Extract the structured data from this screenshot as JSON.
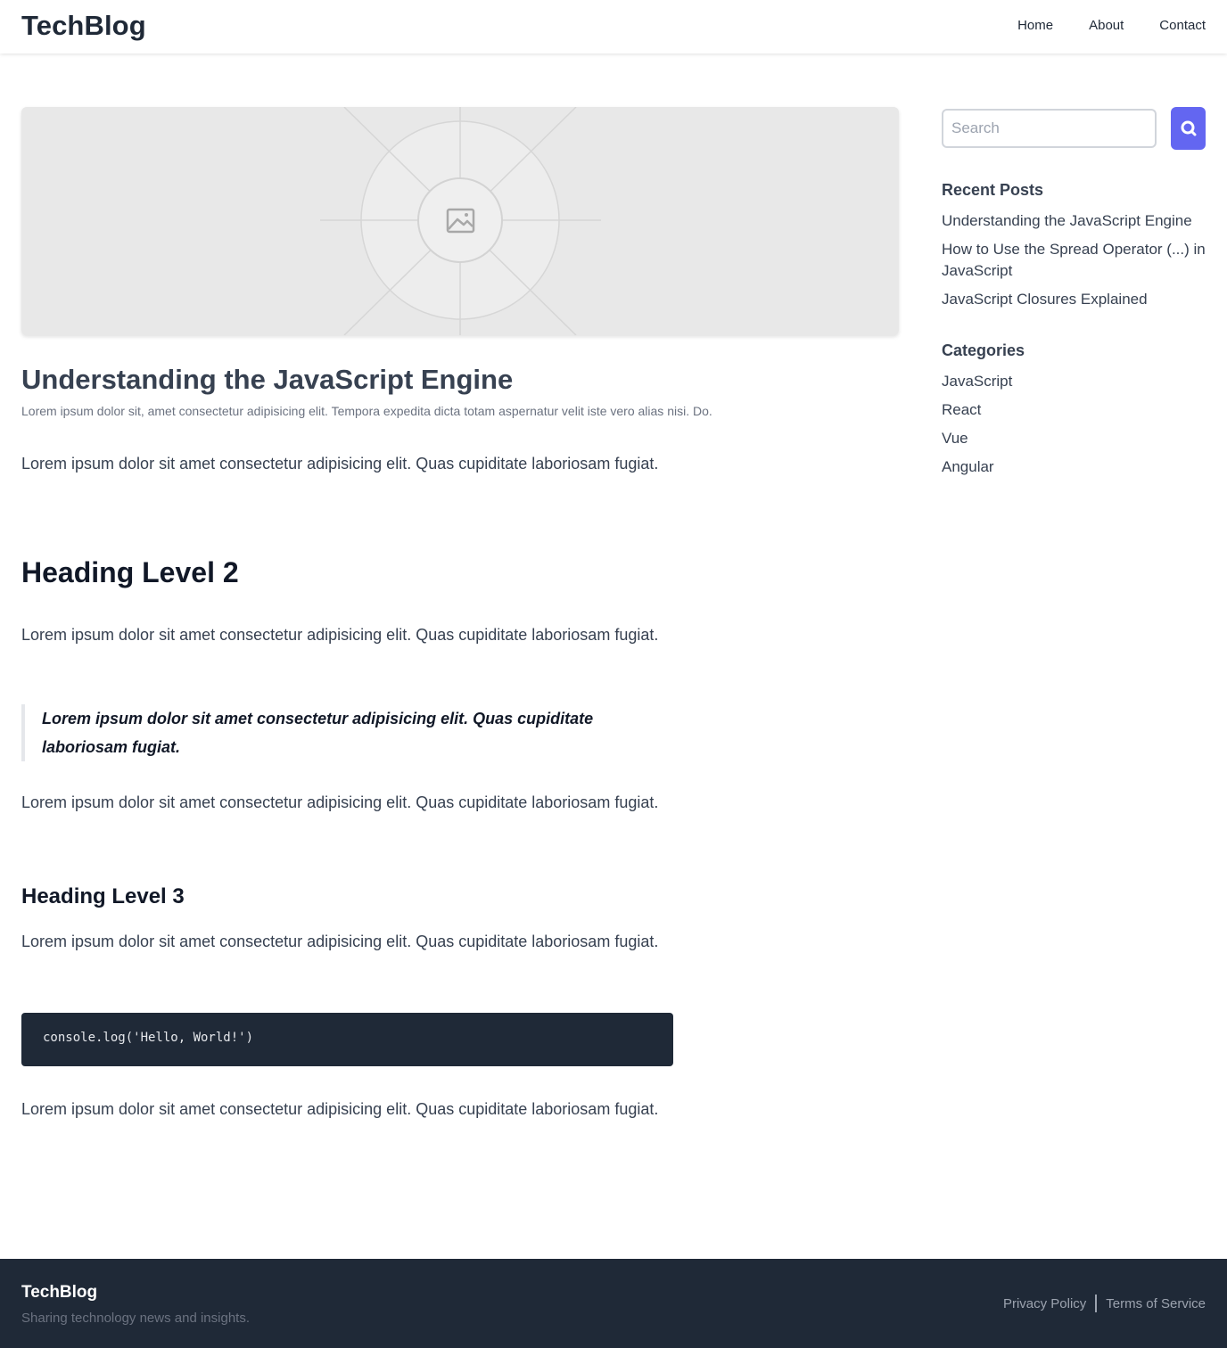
{
  "header": {
    "brand": "TechBlog",
    "nav": [
      "Home",
      "About",
      "Contact"
    ]
  },
  "post": {
    "image": "image-placeholder",
    "title": "Understanding the JavaScript Engine",
    "excerpt": "Lorem ipsum dolor sit, amet consectetur adipisicing elit. Tempora expedita dicta totam aspernatur velit iste vero alias nisi. Do.",
    "paragraph": "Lorem ipsum dolor sit amet consectetur adipisicing elit. Quas cupiditate laboriosam fugiat.",
    "heading2": "Heading Level 2",
    "blockquote": "Lorem ipsum dolor sit amet consectetur adipisicing elit. Quas cupiditate laboriosam fugiat.",
    "heading3": "Heading Level 3",
    "code": "console.log('Hello, World!')"
  },
  "sidebar": {
    "search_placeholder": "Search",
    "search_icon": "search-icon",
    "recent_title": "Recent Posts",
    "recent_posts": [
      "Understanding the JavaScript Engine",
      "How to Use the Spread Operator (...) in JavaScript",
      "JavaScript Closures Explained"
    ],
    "categories_title": "Categories",
    "categories": [
      "JavaScript",
      "React",
      "Vue",
      "Angular"
    ]
  },
  "footer": {
    "brand": "TechBlog",
    "tagline": "Sharing technology news and insights.",
    "links": [
      "Privacy Policy",
      "Terms of Service"
    ]
  },
  "colors": {
    "accent": "#6366f1",
    "dark": "#1f2937",
    "text": "#374151",
    "muted": "#6b7280"
  }
}
